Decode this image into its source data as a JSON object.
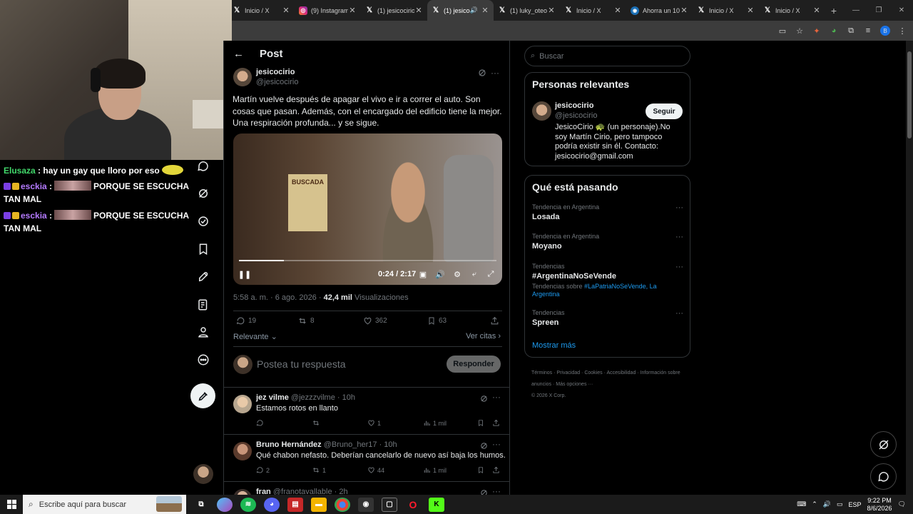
{
  "browser": {
    "tabs": [
      {
        "label": "Inicio / X",
        "icon": "x-icon"
      },
      {
        "label": "(9) Instagram",
        "icon": "instagram-icon"
      },
      {
        "label": "(1) jesicocirio",
        "icon": "x-icon"
      },
      {
        "label": "(1) jesicocirio",
        "icon": "x-icon",
        "active": true
      },
      {
        "label": "(1) luky_oteo",
        "icon": "x-icon"
      },
      {
        "label": "Inicio / X",
        "icon": "x-icon"
      },
      {
        "label": "Ahorra un 10",
        "icon": "steam-icon"
      },
      {
        "label": "Inicio / X",
        "icon": "x-icon"
      },
      {
        "label": "Inicio / X",
        "icon": "x-icon"
      }
    ],
    "profile_initial": "B"
  },
  "stream": {
    "chat": [
      {
        "user": "Elusaza",
        "message": "hay un gay que lloro por eso"
      },
      {
        "user": "esckia",
        "message": "PORQUE SE ESCUCHA TAN MAL"
      },
      {
        "user": "esckia",
        "message": "PORQUE SE ESCUCHA TAN MAL"
      }
    ]
  },
  "post": {
    "header_title": "Post",
    "author_name": "jesicocirio",
    "author_handle": "@jesicocirio",
    "text": "Martín vuelve después de apagar el vivo e ir a correr el auto. Son cosas que pasan. Además, con el encargado del edificio tiene la mejor. Una respiración profunda... y se sigue.",
    "video": {
      "poster_text": "BUSCADA",
      "time": "0:24 / 2:17",
      "progress": 0.175
    },
    "meta_time": "5:58 a. m. · 6 ago. 2026 ·",
    "meta_views_count": "42,4 mil",
    "meta_views_label": "Visualizaciones",
    "stats": {
      "replies": "19",
      "reposts": "8",
      "likes": "362",
      "bookmarks": "63"
    },
    "sort_label": "Relevante",
    "quotes_label": "Ver citas",
    "reply_placeholder": "Postea tu respuesta",
    "reply_button": "Responder"
  },
  "replies": [
    {
      "name": "jez vilme",
      "meta": "@jezzzvilme · 10h",
      "text": "Estamos rotos en llanto",
      "replies": "",
      "reposts": "",
      "likes": "1",
      "views": "1 mil"
    },
    {
      "name": "Bruno Hernández",
      "meta": "@Bruno_her17 · 10h",
      "text": "Qué chabon nefasto. Deberían cancelarlo de nuevo así baja los humos.",
      "replies": "2",
      "reposts": "1",
      "likes": "44",
      "views": "1 mil"
    },
    {
      "name": "fran",
      "meta": "@franotavallable · 2h",
      "text": ""
    }
  ],
  "sidebar": {
    "search_placeholder": "Buscar",
    "relevant_title": "Personas relevantes",
    "relevant_name": "jesicocirio",
    "relevant_handle": "@jesicocirio",
    "follow_label": "Seguir",
    "relevant_bio_1": "JesicoCirio",
    "relevant_bio_2": "(un personaje).No soy Martín Cirio, pero tampoco podría existir sin él. Contacto: jesicocirio@gmail.com",
    "trends_title": "Qué está pasando",
    "trends": [
      {
        "context": "Tendencia en Argentina",
        "name": "Losada"
      },
      {
        "context": "Tendencia en Argentina",
        "name": "Moyano"
      },
      {
        "context": "Tendencias",
        "name": "#ArgentinaNoSeVende",
        "sub_prefix": "Tendencias sobre",
        "sub_link": "#LaPatriaNoSeVende, La Argentina"
      },
      {
        "context": "Tendencias",
        "name": "Spreen"
      }
    ],
    "show_more": "Mostrar más",
    "footer_links": [
      "Términos",
      "Privacidad",
      "Cookies",
      "Accesibilidad",
      "Información sobre anuncios",
      "Más opciones ···"
    ],
    "copyright": "© 2026 X Corp."
  },
  "taskbar": {
    "search_placeholder": "Escribe aquí para buscar",
    "language": "ESP",
    "time": "9:22 PM",
    "date": "8/6/2026"
  }
}
